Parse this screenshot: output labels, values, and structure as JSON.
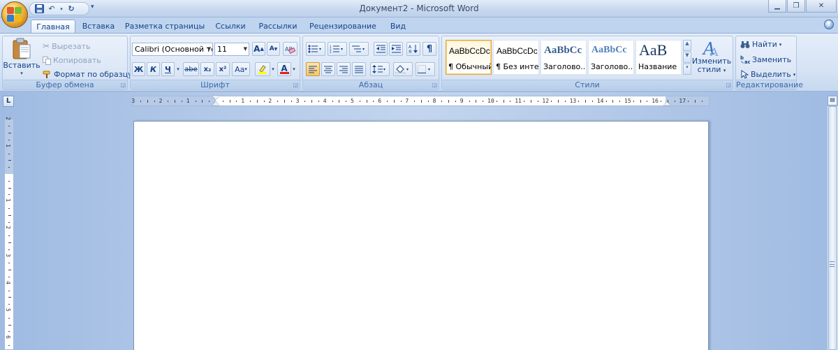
{
  "titlebar": {
    "title": "Документ2 - Microsoft Word",
    "qat_more": "▾"
  },
  "tabs": [
    {
      "label": "Главная",
      "active": true
    },
    {
      "label": "Вставка"
    },
    {
      "label": "Разметка страницы"
    },
    {
      "label": "Ссылки"
    },
    {
      "label": "Рассылки"
    },
    {
      "label": "Рецензирование"
    },
    {
      "label": "Вид"
    }
  ],
  "clipboard": {
    "paste": "Вставить",
    "cut": "Вырезать",
    "copy": "Копировать",
    "format_painter": "Формат по образцу",
    "group_label": "Буфер обмена"
  },
  "font": {
    "font_name": "Calibri (Основной те",
    "font_size": "11",
    "group_label": "Шрифт",
    "bold": "Ж",
    "italic": "К",
    "underline": "Ч",
    "strike": "abe",
    "subscript": "x₂",
    "superscript": "x²",
    "change_case": "Aa",
    "grow": "A",
    "shrink": "A",
    "font_color_letter": "A",
    "highlight_color": "#ffff00",
    "font_color": "#e02020"
  },
  "paragraph": {
    "group_label": "Абзац",
    "show_marks": "¶"
  },
  "styles": {
    "group_label": "Стили",
    "items": [
      {
        "sample": "AaBbCcDc",
        "name": "¶ Обычный"
      },
      {
        "sample": "AaBbCcDc",
        "name": "¶ Без инте..."
      },
      {
        "sample": "AaBbCc",
        "name": "Заголово..."
      },
      {
        "sample": "AaBbCc",
        "name": "Заголово..."
      },
      {
        "sample": "AaB",
        "name": "Название"
      }
    ],
    "change_styles_line1": "Изменить",
    "change_styles_line2": "стили"
  },
  "editing": {
    "group_label": "Редактирование",
    "find": "Найти",
    "replace": "Заменить",
    "select": "Выделить"
  },
  "ruler": {
    "toggle_label": "L",
    "h_labels": [
      "3",
      "2",
      "1",
      "1",
      "2",
      "3",
      "4",
      "5",
      "6",
      "7",
      "8",
      "9",
      "10",
      "11",
      "12",
      "13",
      "14",
      "15",
      "16",
      "17"
    ],
    "v_labels": [
      "2",
      "1",
      "1",
      "2",
      "3",
      "4",
      "5",
      "6"
    ]
  }
}
